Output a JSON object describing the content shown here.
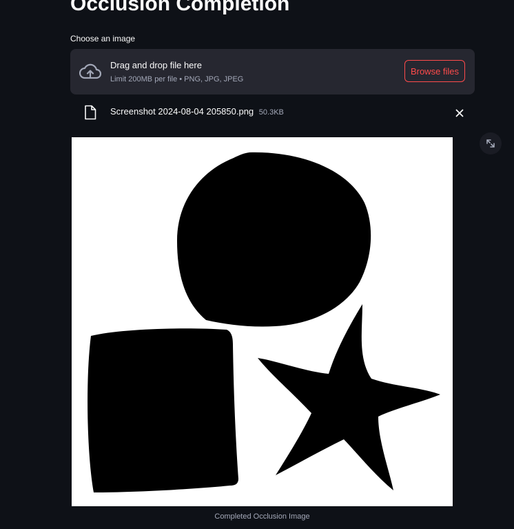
{
  "page": {
    "title": "Occlusion Completion"
  },
  "uploader": {
    "label": "Choose an image",
    "drop_text": "Drag and drop file here",
    "limit_text": "Limit 200MB per file • PNG, JPG, JPEG",
    "browse_label": "Browse files",
    "cloud_icon": "cloud-upload-icon"
  },
  "file": {
    "name": "Screenshot 2024-08-04 205850.png",
    "size": "50.3KB",
    "file_icon": "file-icon",
    "remove_icon": "close-icon"
  },
  "image": {
    "caption": "Completed Occlusion Image",
    "fullscreen_icon": "fullscreen-icon",
    "shapes": [
      "circle",
      "square",
      "star"
    ]
  },
  "colors": {
    "background": "#0e1117",
    "dropzone": "#262730",
    "accent": "#ff4b4b",
    "muted_text": "#a3a8b8"
  }
}
